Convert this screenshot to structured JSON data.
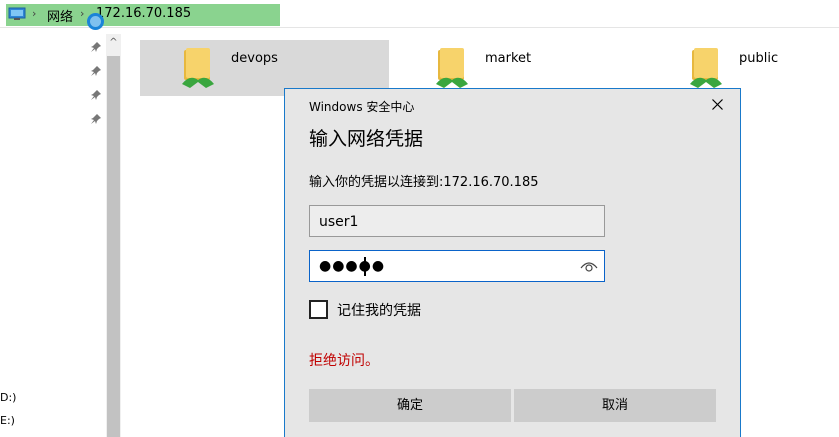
{
  "address_bar": {
    "crumbs": [
      "网络",
      "172.16.70.185"
    ],
    "icon": "network-computer-icon"
  },
  "nav": {
    "pins": [
      "pin-icon",
      "pin-icon",
      "pin-icon",
      "pin-icon"
    ],
    "drives": [
      "D:)",
      "E:)"
    ]
  },
  "folders": [
    {
      "name": "devops",
      "selected": true
    },
    {
      "name": "market",
      "selected": false
    },
    {
      "name": "public",
      "selected": false
    }
  ],
  "dialog": {
    "window_title": "Windows 安全中心",
    "heading": "输入网络凭据",
    "description": "输入你的凭据以连接到:172.16.70.185",
    "username_value": "user1",
    "password_mask": "●●●●●",
    "remember_label": "记住我的凭据",
    "remember_checked": false,
    "error_text": "拒绝访问。",
    "ok_label": "确定",
    "cancel_label": "取消",
    "accent_color": "#1979ca",
    "error_color": "#c00000"
  }
}
